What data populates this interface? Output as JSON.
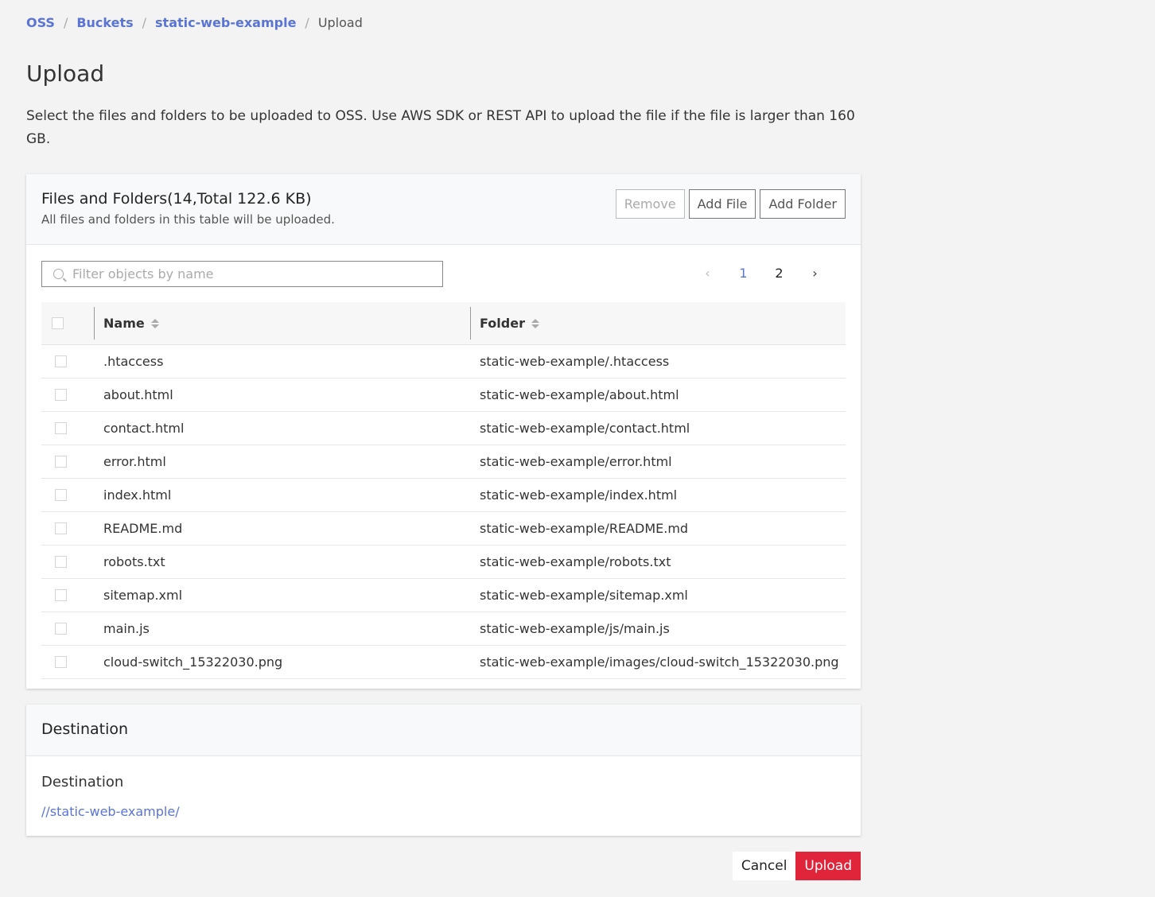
{
  "breadcrumb": {
    "items": [
      "OSS",
      "Buckets",
      "static-web-example"
    ],
    "current": "Upload",
    "separator": "/"
  },
  "page": {
    "title": "Upload",
    "description": "Select the files and folders to be uploaded to OSS. Use AWS SDK or REST API to upload the file if the file is larger than 160 GB."
  },
  "files_card": {
    "title": "Files and Folders(14,Total 122.6 KB)",
    "subtitle": "All files and folders in this table will be uploaded.",
    "remove_label": "Remove",
    "add_file_label": "Add File",
    "add_folder_label": "Add Folder",
    "filter_placeholder": "Filter objects by name",
    "pagination": {
      "prev": "‹",
      "pages": [
        "1",
        "2"
      ],
      "next": "›"
    },
    "columns": {
      "name": "Name",
      "folder": "Folder"
    },
    "rows": [
      {
        "name": ".htaccess",
        "folder": "static-web-example/.htaccess"
      },
      {
        "name": "about.html",
        "folder": "static-web-example/about.html"
      },
      {
        "name": "contact.html",
        "folder": "static-web-example/contact.html"
      },
      {
        "name": "error.html",
        "folder": "static-web-example/error.html"
      },
      {
        "name": "index.html",
        "folder": "static-web-example/index.html"
      },
      {
        "name": "README.md",
        "folder": "static-web-example/README.md"
      },
      {
        "name": "robots.txt",
        "folder": "static-web-example/robots.txt"
      },
      {
        "name": "sitemap.xml",
        "folder": "static-web-example/sitemap.xml"
      },
      {
        "name": "main.js",
        "folder": "static-web-example/js/main.js"
      },
      {
        "name": "cloud-switch_15322030.png",
        "folder": "static-web-example/images/cloud-switch_15322030.png"
      }
    ]
  },
  "destination_card": {
    "title": "Destination",
    "label": "Destination",
    "path": "//static-web-example/"
  },
  "footer": {
    "cancel_label": "Cancel",
    "upload_label": "Upload"
  },
  "colors": {
    "link": "#5a74d6",
    "primary": "#e0253b",
    "background": "#f2f3f2"
  }
}
